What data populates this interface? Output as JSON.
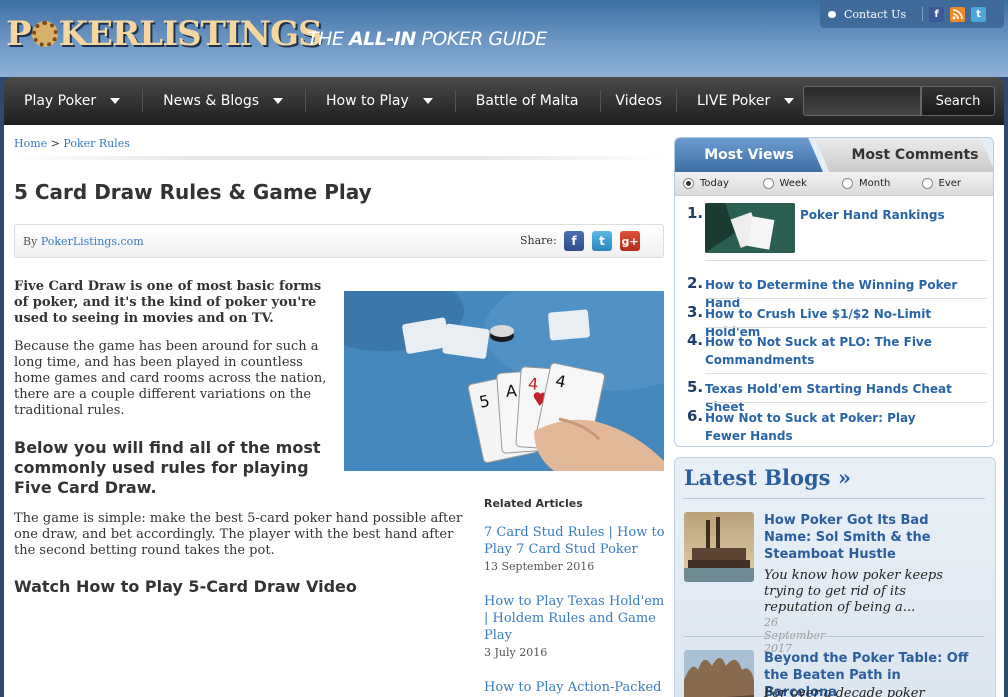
{
  "header": {
    "logo_text": "POKERLISTINGS",
    "tagline_prefix": "THE",
    "tagline_bold": "ALL-IN",
    "tagline_suffix": "POKER GUIDE",
    "contact_label": "Contact Us"
  },
  "nav": {
    "items": [
      {
        "label": "Play Poker",
        "dropdown": true
      },
      {
        "label": "News & Blogs",
        "dropdown": true
      },
      {
        "label": "How to Play",
        "dropdown": true
      },
      {
        "label": "Battle of Malta",
        "dropdown": false
      },
      {
        "label": "Videos",
        "dropdown": false
      },
      {
        "label": "LIVE Poker",
        "dropdown": true
      }
    ],
    "search_value": "",
    "search_button": "Search"
  },
  "breadcrumb": {
    "home": "Home",
    "separator": ">",
    "current": "Poker Rules"
  },
  "article": {
    "title": "5 Card Draw Rules & Game Play",
    "by_prefix": "By",
    "author": "PokerListings.com",
    "share_label": "Share:",
    "lead": "Five Card Draw is one of most basic forms of poker, and it's the kind of poker you're used to seeing in movies and on TV.",
    "para1": "Because the game has been around for such a long time, and has been played in countless home games and card rooms across the nation, there are a couple different variations on the traditional rules.",
    "subhead1": "Below you will find all of the most commonly used rules for playing Five Card Draw.",
    "para2": "The game is simple: make the best 5-card poker hand possible after one draw, and bet accordingly. The player with the best hand after the second betting round takes the pot.",
    "subhead2": "Watch How to Play 5-Card Draw Video"
  },
  "related": {
    "heading": "Related Articles",
    "items": [
      {
        "title": "7 Card Stud Rules | How to Play 7 Card Stud Poker",
        "date": "13 September 2016"
      },
      {
        "title": "How to Play Texas Hold'em | Holdem Rules and Game Play",
        "date": "3 July 2016"
      },
      {
        "title": "How to Play Action-Packed Pot Limit Omaha Poker",
        "date": ""
      }
    ]
  },
  "most": {
    "tab_views": "Most Views",
    "tab_comments": "Most Comments",
    "periods": [
      "Today",
      "Week",
      "Month",
      "Ever"
    ],
    "selected_period": "Today",
    "items": [
      {
        "n": "1.",
        "title": "Poker Hand Rankings"
      },
      {
        "n": "2.",
        "title": "How to Determine the Winning Poker Hand"
      },
      {
        "n": "3.",
        "title": "How to Crush Live $1/$2 No-Limit Hold'em"
      },
      {
        "n": "4.",
        "title": "How to Not Suck at PLO: The Five Commandments"
      },
      {
        "n": "5.",
        "title": "Texas Hold'em Starting Hands Cheat Sheet"
      },
      {
        "n": "6.",
        "title": "How Not to Suck at Poker: Play Fewer Hands"
      }
    ]
  },
  "latest": {
    "heading": "Latest Blogs »",
    "items": [
      {
        "title": "How Poker Got Its Bad Name: Sol Smith & the Steamboat Hustle",
        "excerpt": "You know how poker keeps trying to get rid of its reputation of being a...",
        "date": "26 September 2017"
      },
      {
        "title": "Beyond the Poker Table: Off the Beaten Path in Barcelona",
        "excerpt": "For over a decade poker",
        "date": ""
      }
    ]
  },
  "colors": {
    "link": "#3a7bbf",
    "nav_bg": "#1e1e1e",
    "header_bg": "#3d6fa3",
    "tab_active": "#3d6ea6"
  },
  "icons": [
    "facebook-icon",
    "rss-icon",
    "twitter-icon",
    "googleplus-icon",
    "chevron-down-icon"
  ]
}
